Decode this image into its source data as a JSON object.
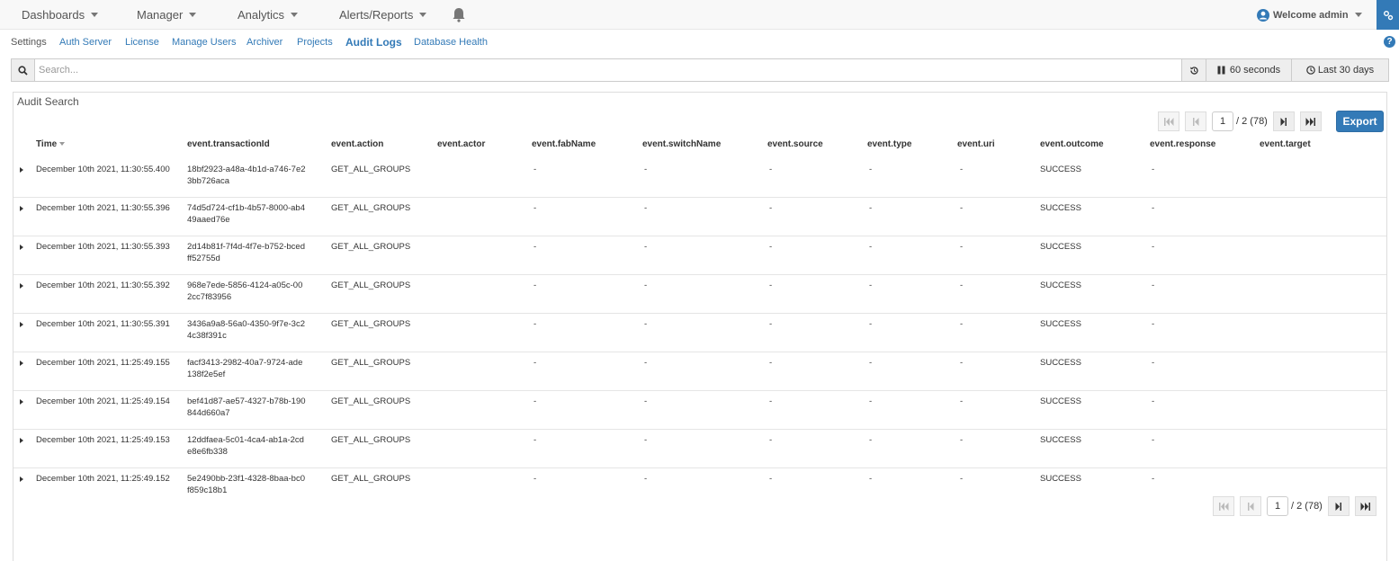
{
  "topnav": {
    "menus": [
      {
        "label": "Dashboards"
      },
      {
        "label": "Manager"
      },
      {
        "label": "Analytics"
      },
      {
        "label": "Alerts/Reports"
      }
    ],
    "welcome": "Welcome admin"
  },
  "subnav": {
    "items": [
      {
        "label": "Settings"
      },
      {
        "label": "Auth Server"
      },
      {
        "label": "License"
      },
      {
        "label": "Manage Users"
      },
      {
        "label": "Archiver"
      },
      {
        "label": "Projects"
      },
      {
        "label": "Audit Logs"
      },
      {
        "label": "Database Health"
      }
    ],
    "active_index": 6
  },
  "search": {
    "placeholder": "Search...",
    "refresh_interval": "60 seconds",
    "time_range": "Last 30 days"
  },
  "panel": {
    "title": "Audit Search",
    "export_label": "Export",
    "pager": {
      "page": "1",
      "total": "/ 2 (78)"
    }
  },
  "table": {
    "columns": [
      "Time",
      "event.transactionId",
      "event.action",
      "event.actor",
      "event.fabName",
      "event.switchName",
      "event.source",
      "event.type",
      "event.uri",
      "event.outcome",
      "event.response",
      "event.target"
    ],
    "rows": [
      {
        "time": "December 10th 2021, 11:30:55.400",
        "txid": "18bf2923-a48a-4b1d-a746-7e23bb726aca",
        "action": "GET_ALL_GROUPS",
        "actor": "",
        "fab": "-",
        "switch": "-",
        "source": "-",
        "type": "-",
        "uri": "-",
        "outcome": "SUCCESS",
        "response": "-",
        "target": ""
      },
      {
        "time": "December 10th 2021, 11:30:55.396",
        "txid": "74d5d724-cf1b-4b57-8000-ab449aaed76e",
        "action": "GET_ALL_GROUPS",
        "actor": "",
        "fab": "-",
        "switch": "-",
        "source": "-",
        "type": "-",
        "uri": "-",
        "outcome": "SUCCESS",
        "response": "-",
        "target": ""
      },
      {
        "time": "December 10th 2021, 11:30:55.393",
        "txid": "2d14b81f-7f4d-4f7e-b752-bcedff52755d",
        "action": "GET_ALL_GROUPS",
        "actor": "",
        "fab": "-",
        "switch": "-",
        "source": "-",
        "type": "-",
        "uri": "-",
        "outcome": "SUCCESS",
        "response": "-",
        "target": ""
      },
      {
        "time": "December 10th 2021, 11:30:55.392",
        "txid": "968e7ede-5856-4124-a05c-002cc7f83956",
        "action": "GET_ALL_GROUPS",
        "actor": "",
        "fab": "-",
        "switch": "-",
        "source": "-",
        "type": "-",
        "uri": "-",
        "outcome": "SUCCESS",
        "response": "-",
        "target": ""
      },
      {
        "time": "December 10th 2021, 11:30:55.391",
        "txid": "3436a9a8-56a0-4350-9f7e-3c24c38f391c",
        "action": "GET_ALL_GROUPS",
        "actor": "",
        "fab": "-",
        "switch": "-",
        "source": "-",
        "type": "-",
        "uri": "-",
        "outcome": "SUCCESS",
        "response": "-",
        "target": ""
      },
      {
        "time": "December 10th 2021, 11:25:49.155",
        "txid": "facf3413-2982-40a7-9724-ade138f2e5ef",
        "action": "GET_ALL_GROUPS",
        "actor": "",
        "fab": "-",
        "switch": "-",
        "source": "-",
        "type": "-",
        "uri": "-",
        "outcome": "SUCCESS",
        "response": "-",
        "target": ""
      },
      {
        "time": "December 10th 2021, 11:25:49.154",
        "txid": "bef41d87-ae57-4327-b78b-190844d660a7",
        "action": "GET_ALL_GROUPS",
        "actor": "",
        "fab": "-",
        "switch": "-",
        "source": "-",
        "type": "-",
        "uri": "-",
        "outcome": "SUCCESS",
        "response": "-",
        "target": ""
      },
      {
        "time": "December 10th 2021, 11:25:49.153",
        "txid": "12ddfaea-5c01-4ca4-ab1a-2cde8e6fb338",
        "action": "GET_ALL_GROUPS",
        "actor": "",
        "fab": "-",
        "switch": "-",
        "source": "-",
        "type": "-",
        "uri": "-",
        "outcome": "SUCCESS",
        "response": "-",
        "target": ""
      },
      {
        "time": "December 10th 2021, 11:25:49.152",
        "txid": "5e2490bb-23f1-4328-8baa-bc0f859c18b1",
        "action": "GET_ALL_GROUPS",
        "actor": "",
        "fab": "-",
        "switch": "-",
        "source": "-",
        "type": "-",
        "uri": "-",
        "outcome": "SUCCESS",
        "response": "-",
        "target": ""
      }
    ]
  },
  "colors": {
    "accent": "#337ab7",
    "navbar": "#f8f8f8",
    "border": "#dddddd"
  },
  "icons": [
    "bell-icon",
    "user-icon",
    "gear-icon",
    "search-icon",
    "history-icon",
    "pause-icon",
    "clock-icon",
    "help-icon",
    "first-page-icon",
    "prev-page-icon",
    "next-page-icon",
    "last-page-icon"
  ]
}
